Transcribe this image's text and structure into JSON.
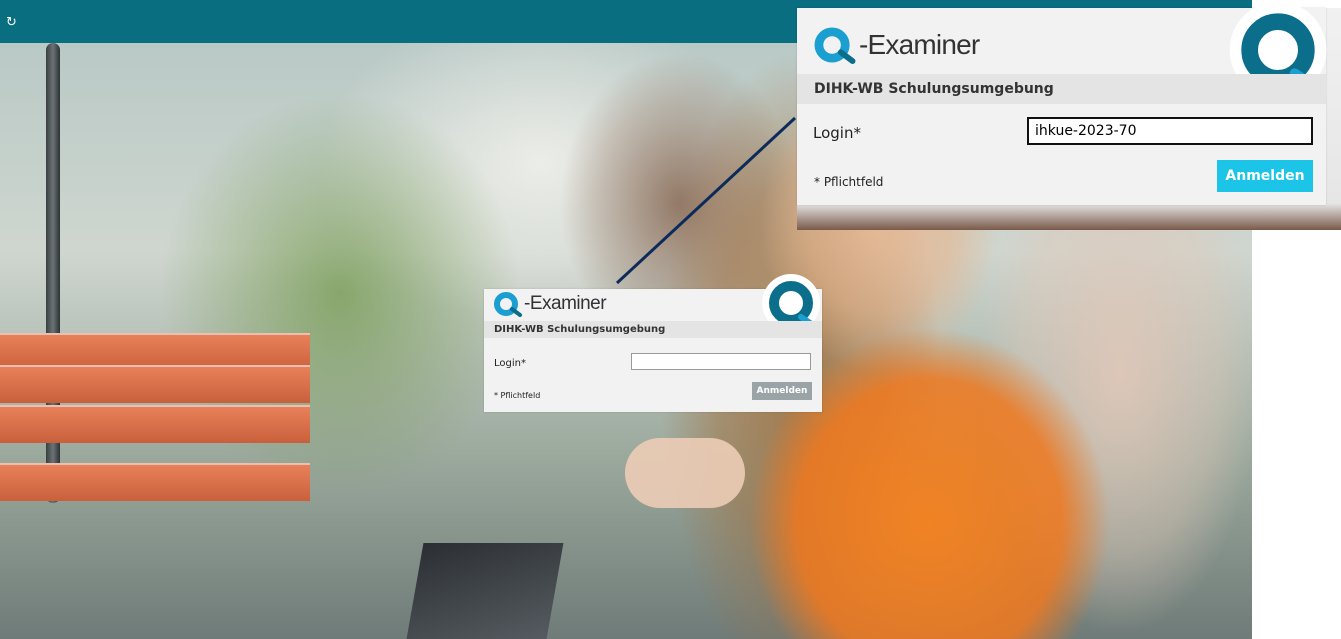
{
  "topbar": {
    "refresh_icon": "refresh-icon",
    "color": "#086e80"
  },
  "login_small": {
    "brand_text": "-Examiner",
    "subtitle": "DIHK-WB Schulungsumgebung",
    "login_label": "Login*",
    "login_value": "",
    "required_note": "* Pflichtfeld",
    "button_label": "Anmelden",
    "button_color": "#9aa4a6"
  },
  "login_zoom": {
    "brand_text": "-Examiner",
    "subtitle": "DIHK-WB Schulungsumgebung",
    "login_label": "Login*",
    "login_value": "ihkue-2023-70",
    "required_note": "* Pflichtfeld",
    "button_label": "Anmelden",
    "button_color": "#1cc4e8"
  },
  "colors": {
    "brand_blue": "#1a9fd0",
    "logo_teal": "#0b6e8a",
    "connector": "#0d2b5a"
  }
}
